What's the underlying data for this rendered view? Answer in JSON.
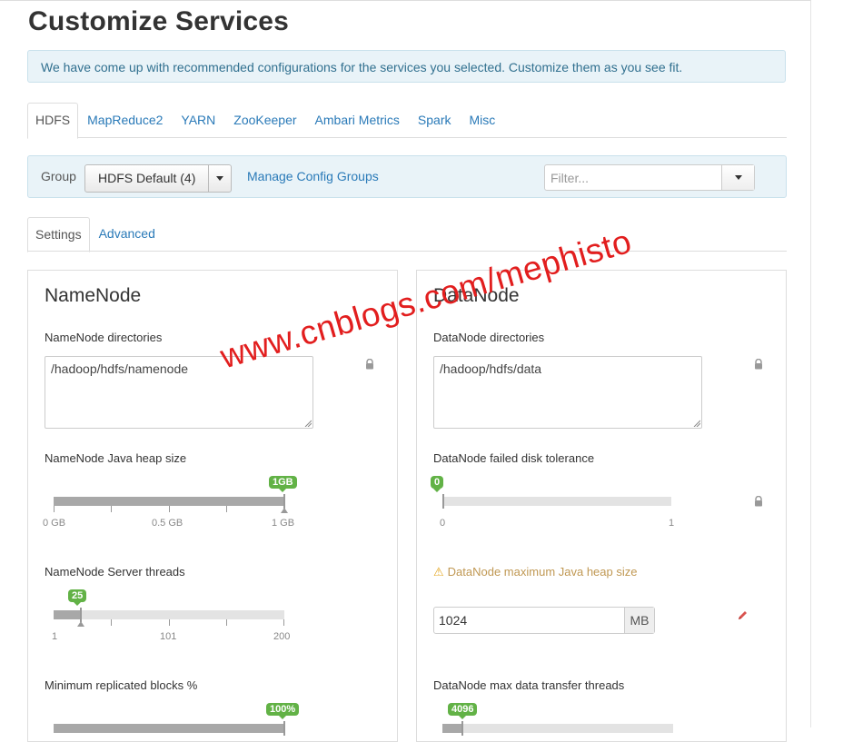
{
  "page": {
    "title": "Customize Services",
    "notice": "We have come up with recommended configurations for the services you selected. Customize them as you see fit."
  },
  "service_tabs": [
    {
      "label": "HDFS",
      "active": true
    },
    {
      "label": "MapReduce2",
      "active": false
    },
    {
      "label": "YARN",
      "active": false
    },
    {
      "label": "ZooKeeper",
      "active": false
    },
    {
      "label": "Ambari Metrics",
      "active": false
    },
    {
      "label": "Spark",
      "active": false
    },
    {
      "label": "Misc",
      "active": false
    }
  ],
  "group_bar": {
    "label": "Group",
    "selected_group": "HDFS Default (4)",
    "manage_link": "Manage Config Groups",
    "filter_placeholder": "Filter...",
    "filter_value": ""
  },
  "sub_tabs": [
    {
      "label": "Settings",
      "active": true
    },
    {
      "label": "Advanced",
      "active": false
    }
  ],
  "namenode": {
    "title": "NameNode",
    "directories_label": "NameNode directories",
    "directories_value": "/hadoop/hdfs/namenode",
    "heap_label": "NameNode Java heap size",
    "heap_badge": "1GB",
    "heap_fraction": 1.0,
    "heap_ticks": [
      "0 GB",
      "0.5 GB",
      "1 GB"
    ],
    "threads_label": "NameNode Server threads",
    "threads_badge": "25",
    "threads_value": 25,
    "threads_ticks": [
      "1",
      "101",
      "200"
    ],
    "min_repl_label": "Minimum replicated blocks %",
    "min_repl_badge": "100%",
    "min_repl_fraction": 1.0
  },
  "datanode": {
    "title": "DataNode",
    "directories_label": "DataNode directories",
    "directories_value": "/hadoop/hdfs/data",
    "disk_tolerance_label": "DataNode failed disk tolerance",
    "disk_tolerance_badge": "0",
    "disk_tolerance_value": 0,
    "disk_tolerance_ticks": [
      "0",
      "1"
    ],
    "max_heap_label": "DataNode maximum Java heap size",
    "max_heap_value": "1024",
    "max_heap_unit": "MB",
    "transfer_threads_label": "DataNode max data transfer threads",
    "transfer_threads_badge": "4096"
  },
  "watermark": "www.cnblogs.com/mephisto",
  "colors": {
    "link": "#2a7ab8",
    "alert_bg": "#e9f3f8",
    "badge": "#62b246",
    "warning": "#c09853",
    "watermark": "#e21e1e"
  }
}
